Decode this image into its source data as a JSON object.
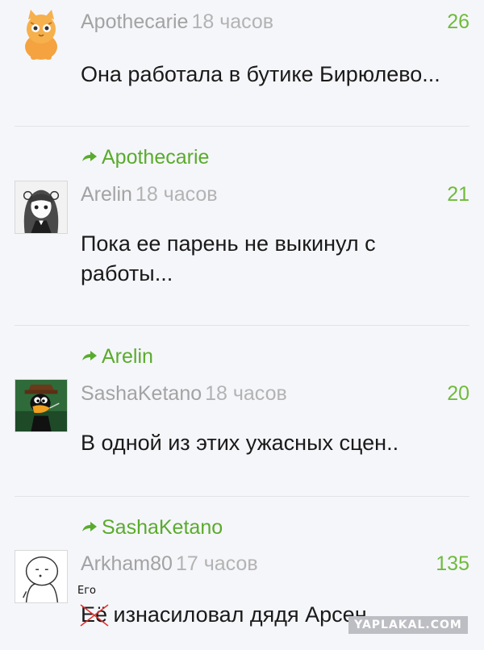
{
  "colors": {
    "background": "#f5f6fa",
    "author": "#a3a3a3",
    "rating": "#6fbb3a",
    "reply_link": "#5aab2d",
    "text": "#1a1a1a",
    "strike": "#e0302a"
  },
  "comments": [
    {
      "avatar": "orange-cat-avatar-icon",
      "author": "Apothecarie",
      "time": "18 часов",
      "rating": "26",
      "text": "Она работала в бутике Бирюлево..."
    },
    {
      "reply_to": "Apothecarie",
      "avatar": "anime-girl-avatar-icon",
      "author": "Arelin",
      "time": "18 часов",
      "rating": "21",
      "text_line1": "Пока ее парень не выкинул с",
      "text_line2": "работы..."
    },
    {
      "reply_to": "Arelin",
      "avatar": "cartoon-duck-avatar-icon",
      "author": "SashaKetano",
      "time": "18 часов",
      "rating": "20",
      "text": "В одной из этих ужасных сцен.."
    },
    {
      "reply_to": "SashaKetano",
      "avatar": "meme-face-avatar-icon",
      "author": "Arkham80",
      "time": "17 часов",
      "rating": "135",
      "struck_word": "Её",
      "correction": "Его",
      "text_rest": "изнасиловал дядя Арсен..."
    }
  ],
  "watermark": "YAPLAKAL.COM"
}
